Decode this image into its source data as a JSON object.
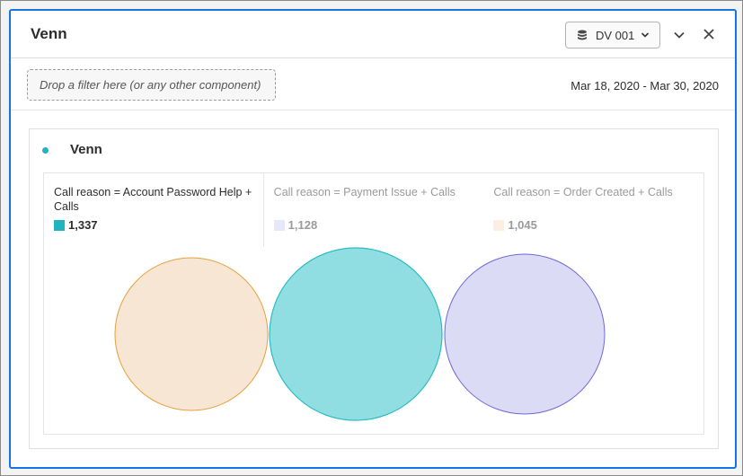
{
  "panel": {
    "title": "Venn"
  },
  "toolbar": {
    "data_view_label": "DV 001",
    "data_view_icon": "database-icon",
    "collapse_icon": "chevron-down-icon",
    "close_icon": "close-icon"
  },
  "filter": {
    "drop_placeholder": "Drop a filter here (or any other component)",
    "date_range": "Mar 18, 2020 - Mar 30, 2020"
  },
  "visualization": {
    "title": "Venn",
    "accent_color": "#1fb4be",
    "legend": [
      {
        "label": "Call reason = Account Password Help + Calls",
        "value": "1,337",
        "color": "#1fb4be",
        "active": true
      },
      {
        "label": "Call reason = Payment Issue + Calls",
        "value": "1,128",
        "color": "#dcdcf6",
        "active": false
      },
      {
        "label": "Call reason = Order Created + Calls",
        "value": "1,045",
        "color": "#fbe5d0",
        "active": false
      }
    ],
    "circles": [
      {
        "fill": "#f8e6d4",
        "stroke": "#e6a03c"
      },
      {
        "fill": "#90dde2",
        "stroke": "#29bcc4"
      },
      {
        "fill": "#dcdbf6",
        "stroke": "#6f68d6"
      }
    ]
  }
}
